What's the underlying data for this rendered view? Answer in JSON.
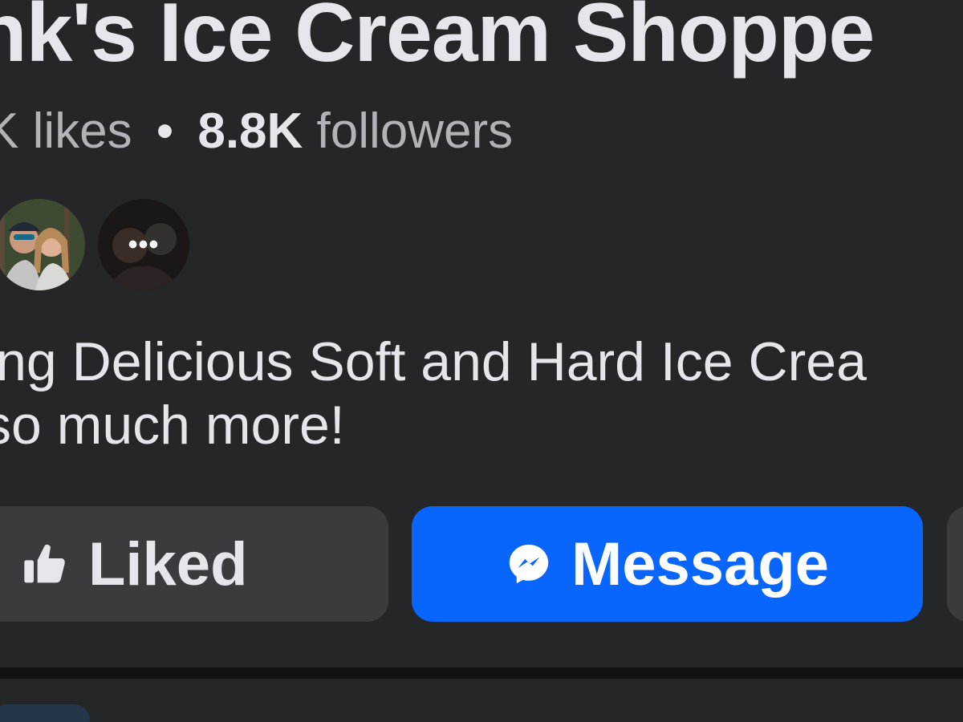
{
  "page": {
    "title": "nk's Ice Cream Shoppe"
  },
  "stats": {
    "likes_fragment": "K",
    "likes_label": "likes",
    "separator": "•",
    "followers_count": "8.8K",
    "followers_label": "followers"
  },
  "friends": {
    "more_indicator": "•••"
  },
  "bio": {
    "line1": "ing Delicious Soft and Hard Ice Crea",
    "line2": "so much more!"
  },
  "actions": {
    "liked_label": "Liked",
    "liked_icon": "thumbs-up-icon",
    "message_label": "Message",
    "message_icon": "messenger-icon"
  },
  "colors": {
    "background": "#252628",
    "primary_text": "#e4e6eb",
    "secondary_text": "#b0b3b8",
    "button_gray": "#3a3b3d",
    "message_blue": "#0866ff"
  }
}
